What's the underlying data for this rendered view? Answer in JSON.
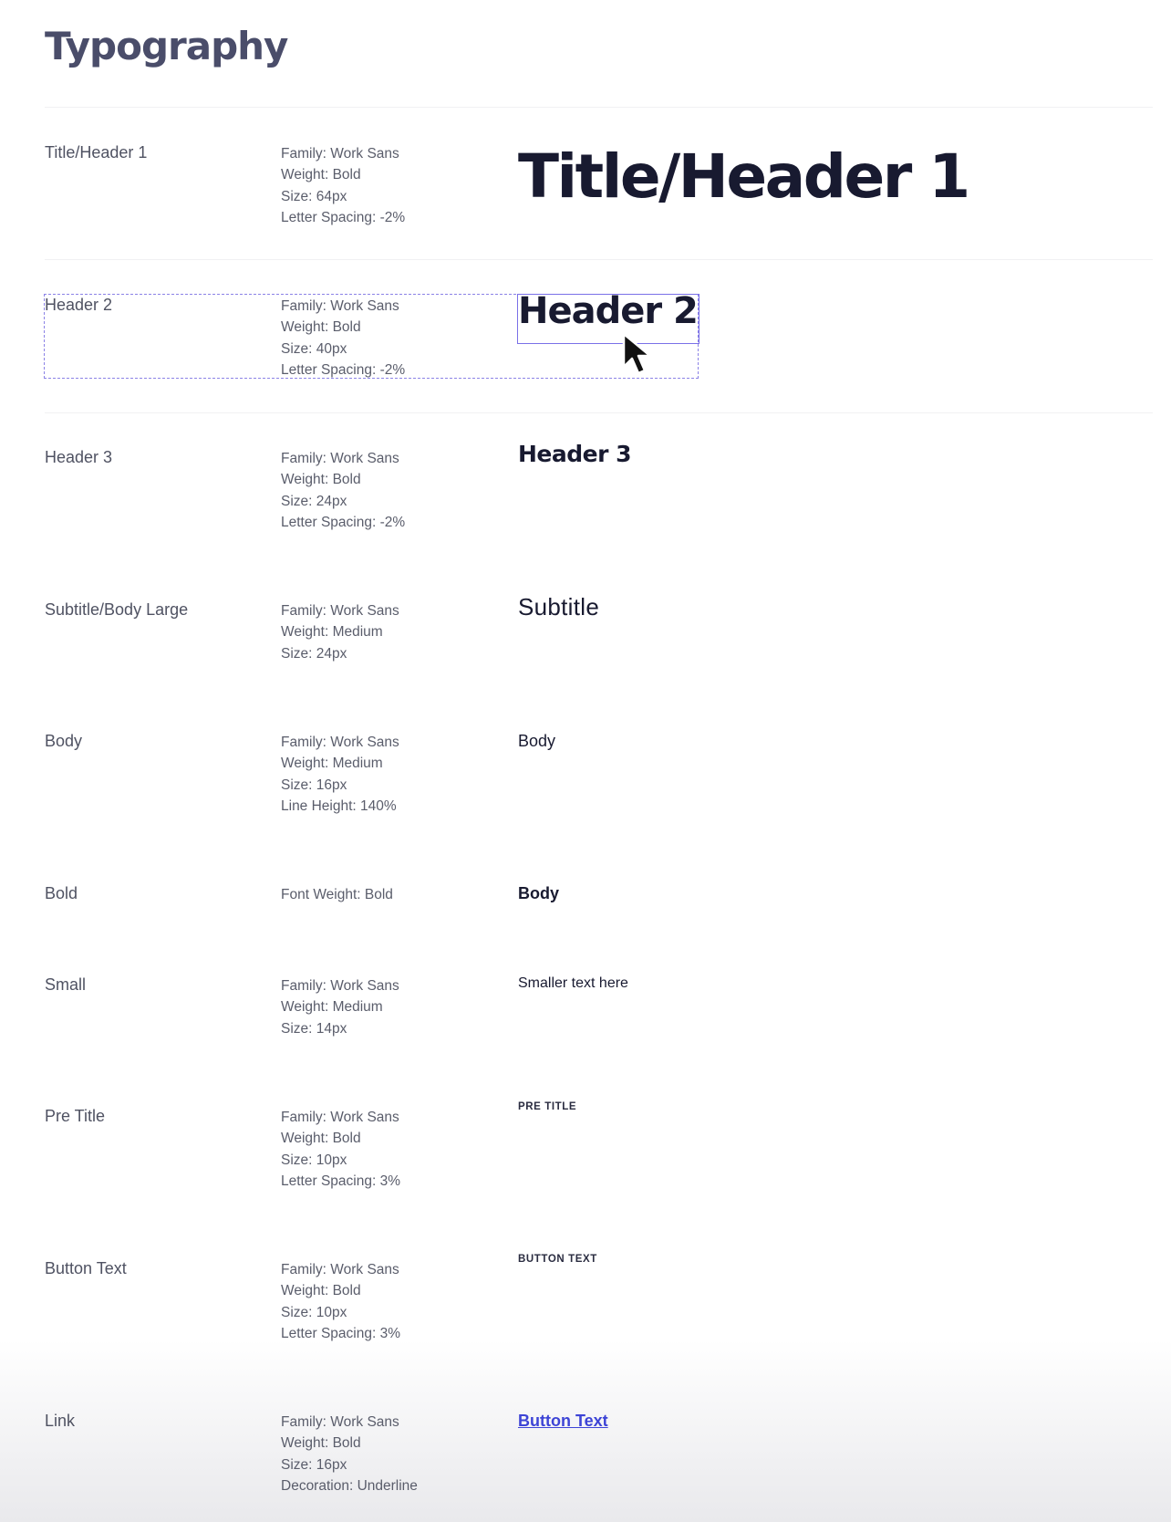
{
  "page": {
    "title": "Typography"
  },
  "styles": [
    {
      "name": "Title/Header 1",
      "spec": [
        "Family: Work Sans",
        "Weight: Bold",
        "Size: 64px",
        "Letter Spacing: -2%"
      ],
      "sample": "Title/Header 1"
    },
    {
      "name": "Header 2",
      "spec": [
        "Family: Work Sans",
        "Weight: Bold",
        "Size: 40px",
        "Letter Spacing: -2%"
      ],
      "sample": "Header 2"
    },
    {
      "name": "Header 3",
      "spec": [
        "Family: Work Sans",
        "Weight: Bold",
        "Size: 24px",
        "Letter Spacing: -2%"
      ],
      "sample": "Header 3"
    },
    {
      "name": "Subtitle/Body Large",
      "spec": [
        "Family: Work Sans",
        "Weight: Medium",
        "Size: 24px"
      ],
      "sample": "Subtitle"
    },
    {
      "name": "Body",
      "spec": [
        "Family: Work Sans",
        "Weight: Medium",
        "Size: 16px",
        "Line Height: 140%"
      ],
      "sample": "Body"
    },
    {
      "name": "Bold",
      "spec": [
        "Font Weight: Bold"
      ],
      "sample": "Body"
    },
    {
      "name": "Small",
      "spec": [
        "Family: Work Sans",
        "Weight: Medium",
        "Size: 14px"
      ],
      "sample": "Smaller text here"
    },
    {
      "name": "Pre Title",
      "spec": [
        "Family: Work Sans",
        "Weight: Bold",
        "Size: 10px",
        "Letter Spacing: 3%"
      ],
      "sample": "PRE TITLE"
    },
    {
      "name": "Button Text",
      "spec": [
        "Family: Work Sans",
        "Weight: Bold",
        "Size: 10px",
        "Letter Spacing: 3%"
      ],
      "sample": "BUTTON TEXT"
    },
    {
      "name": "Link",
      "spec": [
        "Family: Work Sans",
        "Weight: Bold",
        "Size: 16px",
        "Decoration: Underline"
      ],
      "sample": "Button Text"
    }
  ],
  "colors": {
    "title": "#4a4d6a",
    "sample_text": "#181a30",
    "link": "#3d44d6",
    "selection": "#7a70e8"
  },
  "icons": {
    "cursor": "arrow-cursor-icon"
  }
}
